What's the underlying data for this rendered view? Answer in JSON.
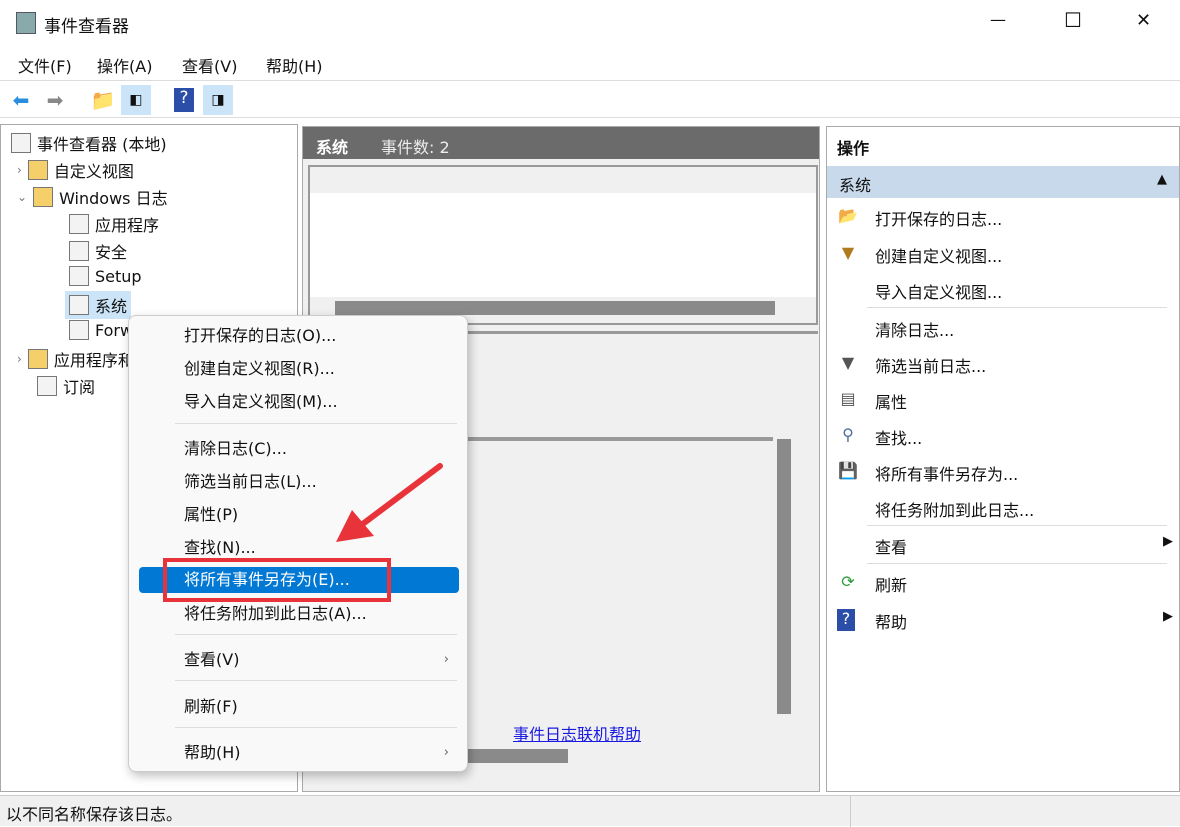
{
  "window": {
    "title": "事件查看器",
    "minimize": "—",
    "maximize": "☐",
    "close": "✕"
  },
  "menubar": [
    "文件(F)",
    "操作(A)",
    "查看(V)",
    "帮助(H)"
  ],
  "toolbar": {
    "icons": [
      "back-arrow-icon",
      "forward-arrow-icon",
      "up-folder-icon",
      "show-hide-tree-icon",
      "help-icon",
      "show-hide-actions-icon"
    ]
  },
  "tree": {
    "root": "事件查看器 (本地)",
    "items": [
      "自定义视图",
      "Windows 日志",
      "应用程序",
      "安全",
      "Setup",
      "系统",
      "Forwarded Events",
      "应用程序和服务日志",
      "订阅"
    ]
  },
  "center": {
    "header_name": "系统",
    "header_count": "事件数: 2",
    "help_link": "事件日志联机帮助"
  },
  "actions": {
    "title": "操作",
    "section": "系统",
    "items": [
      "打开保存的日志...",
      "创建自定义视图...",
      "导入自定义视图...",
      "清除日志...",
      "筛选当前日志...",
      "属性",
      "查找...",
      "将所有事件另存为...",
      "将任务附加到此日志...",
      "查看",
      "刷新",
      "帮助"
    ]
  },
  "context_menu": {
    "items": [
      "打开保存的日志(O)...",
      "创建自定义视图(R)...",
      "导入自定义视图(M)...",
      "清除日志(C)...",
      "筛选当前日志(L)...",
      "属性(P)",
      "查找(N)...",
      "将所有事件另存为(E)...",
      "将任务附加到此日志(A)...",
      "查看(V)",
      "刷新(F)",
      "帮助(H)"
    ],
    "highlighted": "将所有事件另存为(E)..."
  },
  "status": "以不同名称保存该日志。",
  "colors": {
    "highlight": "#0078d4",
    "annotation": "#e8333a",
    "center_header": "#6b6b6b",
    "section_bar": "#c9d9ec"
  }
}
